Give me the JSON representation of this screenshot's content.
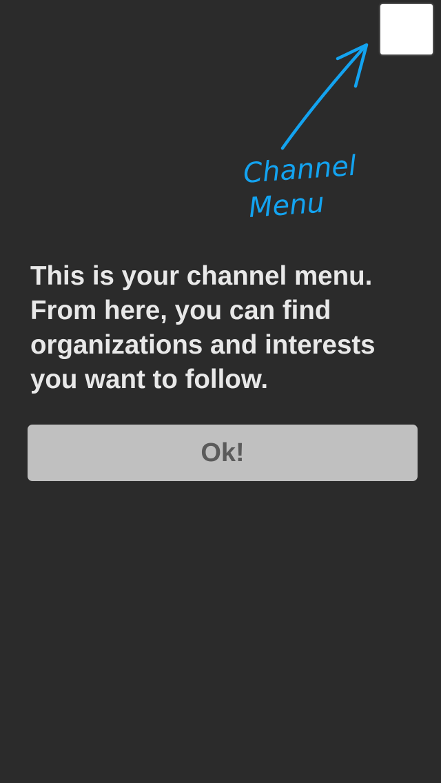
{
  "annotation": {
    "line1": "Channel",
    "line2": "Menu",
    "color": "#13a3f0"
  },
  "tutorial": {
    "message": "This is your channel menu. From here, you can find organizations and interests you want to follow."
  },
  "ok_button": {
    "label": "Ok!"
  },
  "colors": {
    "background": "#2b2b2b",
    "button": "#c0c0c0",
    "text": "#e8e8e8",
    "annotation": "#13a3f0"
  }
}
